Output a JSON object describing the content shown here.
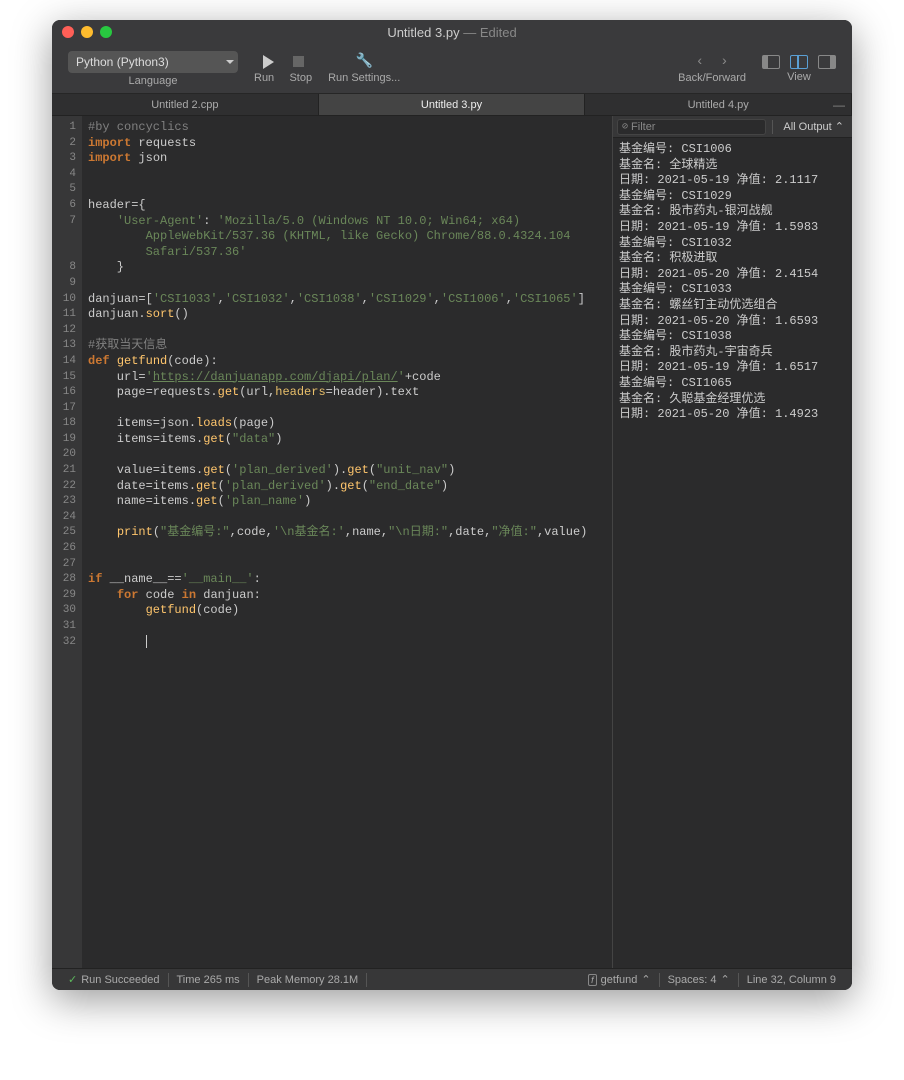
{
  "window": {
    "title": "Untitled 3.py",
    "subtitle": "— Edited"
  },
  "toolbar": {
    "language": "Python (Python3)",
    "language_label": "Language",
    "run_label": "Run",
    "stop_label": "Stop",
    "run_settings_label": "Run Settings...",
    "back_forward_label": "Back/Forward",
    "view_label": "View"
  },
  "tabs": [
    {
      "label": "Untitled 2.cpp",
      "active": false
    },
    {
      "label": "Untitled 3.py",
      "active": true
    },
    {
      "label": "Untitled 4.py",
      "active": false
    }
  ],
  "code_lines": [
    {
      "n": 1,
      "tokens": [
        {
          "t": "#by concyclics",
          "c": "c-comment"
        }
      ]
    },
    {
      "n": 2,
      "tokens": [
        {
          "t": "import",
          "c": "c-key"
        },
        {
          "t": " "
        },
        {
          "t": "requests",
          "c": ""
        }
      ]
    },
    {
      "n": 3,
      "tokens": [
        {
          "t": "import",
          "c": "c-key"
        },
        {
          "t": " "
        },
        {
          "t": "json",
          "c": ""
        }
      ]
    },
    {
      "n": 4,
      "tokens": []
    },
    {
      "n": 5,
      "tokens": []
    },
    {
      "n": 6,
      "tokens": [
        {
          "t": "header={",
          "c": ""
        }
      ]
    },
    {
      "n": 7,
      "tokens": [
        {
          "t": "    "
        },
        {
          "t": "'User-Agent'",
          "c": "c-str"
        },
        {
          "t": ": "
        },
        {
          "t": "'Mozilla/5.0 (Windows NT 10.0; Win64; x64)\n        AppleWebKit/537.36 (KHTML, like Gecko) Chrome/88.0.4324.104\n        Safari/537.36'",
          "c": "c-str"
        }
      ]
    },
    {
      "n": 8,
      "tokens": [
        {
          "t": "    }"
        }
      ]
    },
    {
      "n": 9,
      "tokens": []
    },
    {
      "n": 10,
      "tokens": [
        {
          "t": "danjuan=["
        },
        {
          "t": "'CSI1033'",
          "c": "c-str"
        },
        {
          "t": ","
        },
        {
          "t": "'CSI1032'",
          "c": "c-str"
        },
        {
          "t": ","
        },
        {
          "t": "'CSI1038'",
          "c": "c-str"
        },
        {
          "t": ","
        },
        {
          "t": "'CSI1029'",
          "c": "c-str"
        },
        {
          "t": ","
        },
        {
          "t": "'CSI1006'",
          "c": "c-str"
        },
        {
          "t": ","
        },
        {
          "t": "'CSI1065'",
          "c": "c-str"
        },
        {
          "t": "]"
        }
      ]
    },
    {
      "n": 11,
      "tokens": [
        {
          "t": "danjuan."
        },
        {
          "t": "sort",
          "c": "c-fn"
        },
        {
          "t": "()"
        }
      ]
    },
    {
      "n": 12,
      "tokens": []
    },
    {
      "n": 13,
      "tokens": [
        {
          "t": "#获取当天信息",
          "c": "c-comment"
        }
      ]
    },
    {
      "n": 14,
      "tokens": [
        {
          "t": "def",
          "c": "c-key"
        },
        {
          "t": " "
        },
        {
          "t": "getfund",
          "c": "c-def"
        },
        {
          "t": "(code):"
        }
      ]
    },
    {
      "n": 15,
      "tokens": [
        {
          "t": "    url="
        },
        {
          "t": "'",
          "c": "c-str"
        },
        {
          "t": "https://danjuanapp.com/djapi/plan/",
          "c": "c-url"
        },
        {
          "t": "'",
          "c": "c-str"
        },
        {
          "t": "+code"
        }
      ]
    },
    {
      "n": 16,
      "tokens": [
        {
          "t": "    page=requests."
        },
        {
          "t": "get",
          "c": "c-fn"
        },
        {
          "t": "(url,"
        },
        {
          "t": "headers",
          "c": "c-param"
        },
        {
          "t": "=header).text"
        }
      ]
    },
    {
      "n": 17,
      "tokens": []
    },
    {
      "n": 18,
      "tokens": [
        {
          "t": "    items=json."
        },
        {
          "t": "loads",
          "c": "c-fn"
        },
        {
          "t": "(page)"
        }
      ]
    },
    {
      "n": 19,
      "tokens": [
        {
          "t": "    items=items."
        },
        {
          "t": "get",
          "c": "c-fn"
        },
        {
          "t": "("
        },
        {
          "t": "\"data\"",
          "c": "c-str"
        },
        {
          "t": ")"
        }
      ]
    },
    {
      "n": 20,
      "tokens": []
    },
    {
      "n": 21,
      "tokens": [
        {
          "t": "    value=items."
        },
        {
          "t": "get",
          "c": "c-fn"
        },
        {
          "t": "("
        },
        {
          "t": "'plan_derived'",
          "c": "c-str"
        },
        {
          "t": ")."
        },
        {
          "t": "get",
          "c": "c-fn"
        },
        {
          "t": "("
        },
        {
          "t": "\"unit_nav\"",
          "c": "c-str"
        },
        {
          "t": ")"
        }
      ]
    },
    {
      "n": 22,
      "tokens": [
        {
          "t": "    date=items."
        },
        {
          "t": "get",
          "c": "c-fn"
        },
        {
          "t": "("
        },
        {
          "t": "'plan_derived'",
          "c": "c-str"
        },
        {
          "t": ")."
        },
        {
          "t": "get",
          "c": "c-fn"
        },
        {
          "t": "("
        },
        {
          "t": "\"end_date\"",
          "c": "c-str"
        },
        {
          "t": ")"
        }
      ]
    },
    {
      "n": 23,
      "tokens": [
        {
          "t": "    name=items."
        },
        {
          "t": "get",
          "c": "c-fn"
        },
        {
          "t": "("
        },
        {
          "t": "'plan_name'",
          "c": "c-str"
        },
        {
          "t": ")"
        }
      ]
    },
    {
      "n": 24,
      "tokens": []
    },
    {
      "n": 25,
      "tokens": [
        {
          "t": "    "
        },
        {
          "t": "print",
          "c": "c-fn"
        },
        {
          "t": "("
        },
        {
          "t": "\"基金编号:\"",
          "c": "c-str"
        },
        {
          "t": ",code,"
        },
        {
          "t": "'\\n基金名:'",
          "c": "c-str"
        },
        {
          "t": ",name,"
        },
        {
          "t": "\"\\n日期:\"",
          "c": "c-str"
        },
        {
          "t": ",date,"
        },
        {
          "t": "\"净值:\"",
          "c": "c-str"
        },
        {
          "t": ",value)"
        }
      ]
    },
    {
      "n": 26,
      "tokens": []
    },
    {
      "n": 27,
      "tokens": []
    },
    {
      "n": 28,
      "tokens": [
        {
          "t": "if",
          "c": "c-key"
        },
        {
          "t": " __name__=="
        },
        {
          "t": "'__main__'",
          "c": "c-str"
        },
        {
          "t": ":"
        }
      ]
    },
    {
      "n": 29,
      "tokens": [
        {
          "t": "    "
        },
        {
          "t": "for",
          "c": "c-key"
        },
        {
          "t": " code "
        },
        {
          "t": "in",
          "c": "c-key"
        },
        {
          "t": " danjuan:"
        }
      ]
    },
    {
      "n": 30,
      "tokens": [
        {
          "t": "        "
        },
        {
          "t": "getfund",
          "c": "c-fn"
        },
        {
          "t": "(code)"
        }
      ]
    },
    {
      "n": 31,
      "tokens": []
    },
    {
      "n": 32,
      "tokens": [
        {
          "t": "        "
        }
      ],
      "cursor": true
    }
  ],
  "output": {
    "filter_placeholder": "Filter",
    "dropdown": "All Output",
    "lines": [
      "基金编号: CSI1006",
      "基金名: 全球精选",
      "日期: 2021-05-19 净值: 2.1117",
      "基金编号: CSI1029",
      "基金名: 股市药丸-银河战舰",
      "日期: 2021-05-19 净值: 1.5983",
      "基金编号: CSI1032",
      "基金名: 积极进取",
      "日期: 2021-05-20 净值: 2.4154",
      "基金编号: CSI1033",
      "基金名: 螺丝钉主动优选组合",
      "日期: 2021-05-20 净值: 1.6593",
      "基金编号: CSI1038",
      "基金名: 股市药丸-宇宙奇兵",
      "日期: 2021-05-19 净值: 1.6517",
      "基金编号: CSI1065",
      "基金名: 久聪基金经理优选",
      "日期: 2021-05-20 净值: 1.4923"
    ]
  },
  "status": {
    "run": "Run Succeeded",
    "time": "Time 265 ms",
    "memory": "Peak Memory 28.1M",
    "symbol": "getfund",
    "spaces": "Spaces: 4",
    "position": "Line 32, Column 9"
  }
}
